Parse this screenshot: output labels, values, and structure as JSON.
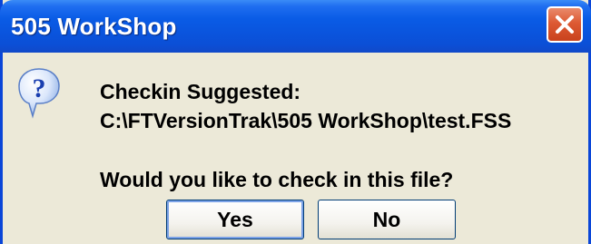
{
  "window": {
    "title": "505 WorkShop"
  },
  "message": {
    "line1": "Checkin Suggested:",
    "line2": "C:\\FTVersionTrak\\505 WorkShop\\test.FSS",
    "question": "Would you like to check in this file?"
  },
  "buttons": {
    "yes_label": "Yes",
    "no_label": "No"
  },
  "icons": {
    "question": "question-icon",
    "close": "close-icon"
  },
  "colors": {
    "titlebar": "#0a55de",
    "dialog_bg": "#ece9d8",
    "close_button": "#dd5a33"
  }
}
